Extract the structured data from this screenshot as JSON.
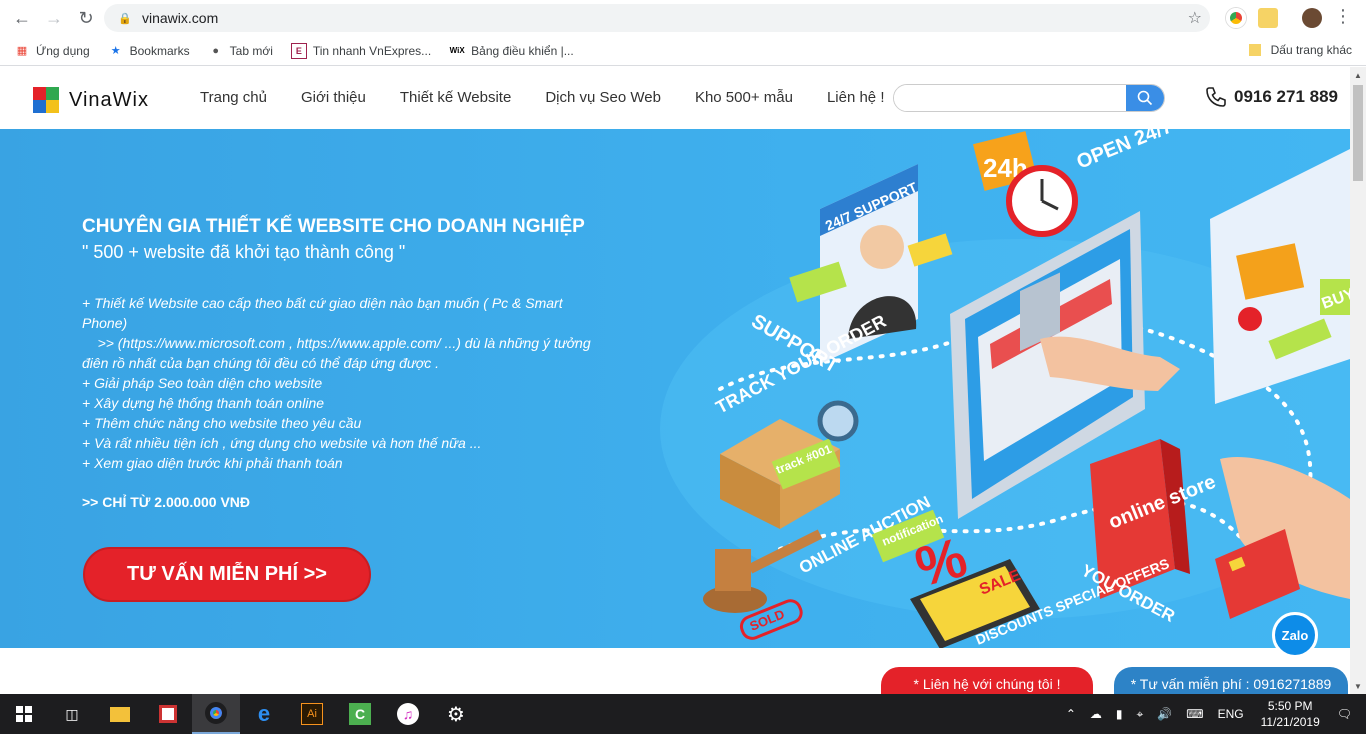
{
  "browser": {
    "url": "vinawix.com",
    "bookmarks": [
      {
        "label": "Ứng dụng",
        "icon": "apps-grid-icon"
      },
      {
        "label": "Bookmarks",
        "icon": "star-icon"
      },
      {
        "label": "Tab mới",
        "icon": "globe-icon"
      },
      {
        "label": "Tin nhanh VnExpres...",
        "icon": "vnexpress-icon"
      },
      {
        "label": "Bảng điều khiển |...",
        "icon": "wix-icon"
      }
    ],
    "other_bookmarks": "Dấu trang khác"
  },
  "header": {
    "logo_text": "VinaWix",
    "menu": [
      "Trang chủ",
      "Giới thiệu",
      "Thiết kế Website",
      "Dịch vụ Seo Web",
      "Kho 500+ mẫu",
      "Liên hệ !"
    ],
    "search_placeholder": "",
    "phone": "0916 271 889"
  },
  "hero": {
    "title": "CHUYÊN GIA THIẾT KẾ WEBSITE CHO DOANH NGHIỆP",
    "subtitle": "\" 500 +  website đã khởi tạo thành công \"",
    "list": [
      "+  Thiết kế Website cao cấp theo bất cứ giao diện nào bạn muốn ( Pc & Smart Phone)",
      "    >> (https://www.microsoft.com , https://www.apple.com/ ...) dù là những ý tưởng điên rồ nhất của bạn chúng tôi đều có thể đáp ứng được .",
      "+  Giải pháp Seo toàn diện cho website",
      "+  Xây dựng hệ thống thanh toán online",
      "+ Thêm chức năng cho website theo yêu cầu",
      "+ Và rất nhiều tiện ích , ứng dụng cho website và hơn thế nữa ...",
      "+ Xem giao diện trước khi phải thanh toán"
    ],
    "price": ">> CHỈ TỪ 2.000.000 VNĐ",
    "cta": "TƯ VẤN MIỄN PHÍ >>",
    "illustration_labels": [
      "24/7 SUPPORT",
      "24h",
      "OPEN 24/7",
      "SUPPORT",
      "TRACK YOUR ORDER",
      "track #001",
      "ONLINE AUCTION",
      "notification",
      "SALE",
      "%",
      "DISCOUNTS SPECIAL OFFERS",
      "online store",
      "YOU ORDER",
      "BUY",
      "SOLD"
    ]
  },
  "floating": {
    "contact": "* Liên hệ với chúng tôi !",
    "consult": "* Tư vấn miễn phí : 0916271889",
    "zalo": "Zalo"
  },
  "taskbar": {
    "lang": "ENG",
    "time": "5:50 PM",
    "date": "11/21/2019"
  },
  "colors": {
    "hero_bg": "#3fb0ee",
    "cta_red": "#e42229",
    "accent_blue": "#2d83c7"
  }
}
